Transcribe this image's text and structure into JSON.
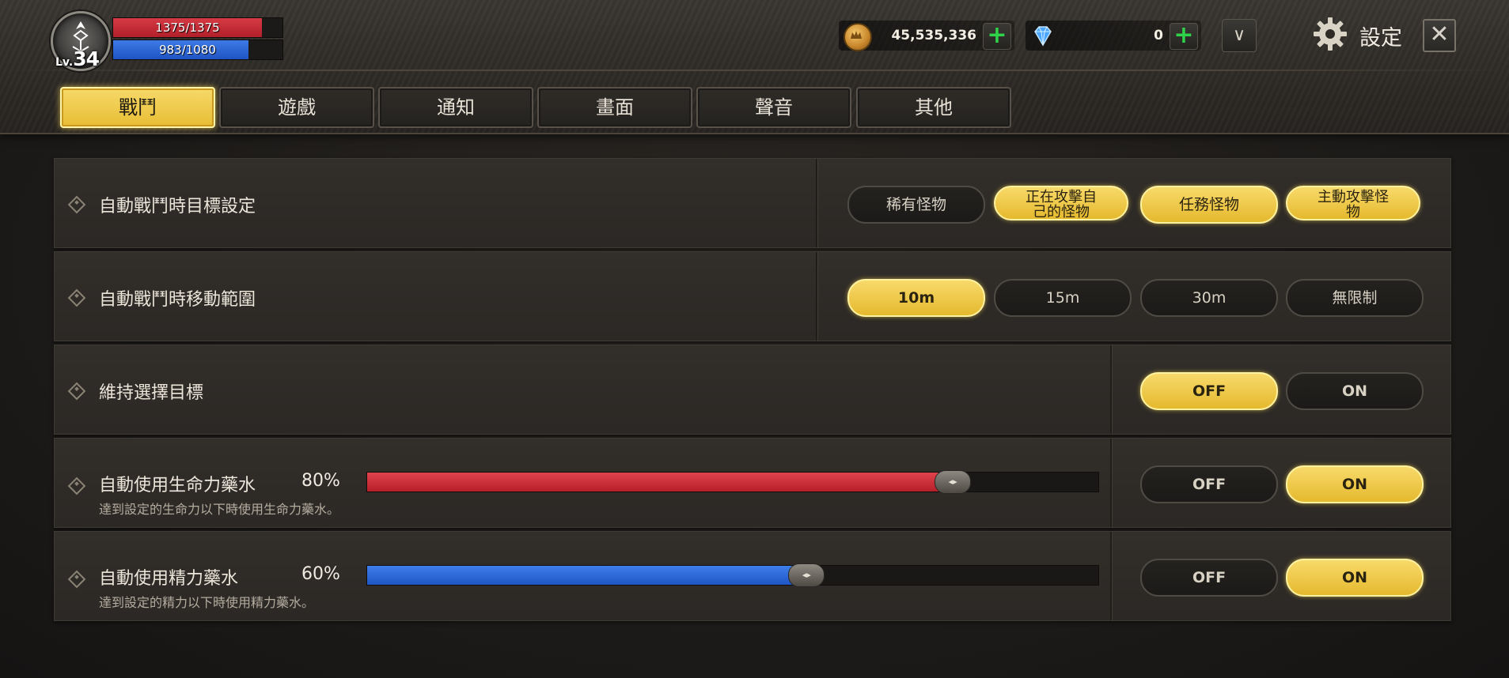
{
  "player": {
    "level_prefix": "Lv.",
    "level": "34",
    "hp_text": "1375/1375",
    "hp_fraction": 1.0,
    "mp_text": "983/1080",
    "mp_fraction": 0.91
  },
  "currency": {
    "gold": "45,535,336",
    "gems": "0",
    "plus_label": "+",
    "dropdown_icon": "∨"
  },
  "header": {
    "settings_label": "設定",
    "close_label": "✕"
  },
  "tabs": [
    {
      "label": "戰鬥",
      "active": true
    },
    {
      "label": "遊戲",
      "active": false
    },
    {
      "label": "通知",
      "active": false
    },
    {
      "label": "畫面",
      "active": false
    },
    {
      "label": "聲音",
      "active": false
    },
    {
      "label": "其他",
      "active": false
    }
  ],
  "rows": {
    "target": {
      "label": "自動戰鬥時目標設定",
      "options": [
        {
          "line1": "稀有怪物",
          "line2": "",
          "selected": false
        },
        {
          "line1": "正在攻擊自",
          "line2": "己的怪物",
          "selected": true
        },
        {
          "line1": "任務怪物",
          "line2": "",
          "selected": true
        },
        {
          "line1": "主動攻擊怪",
          "line2": "物",
          "selected": true
        }
      ]
    },
    "range": {
      "label": "自動戰鬥時移動範圍",
      "options": [
        {
          "label": "10m",
          "selected": true
        },
        {
          "label": "15m",
          "selected": false
        },
        {
          "label": "30m",
          "selected": false
        },
        {
          "label": "無限制",
          "selected": false
        }
      ]
    },
    "keep_target": {
      "label": "維持選擇目標",
      "off_label": "OFF",
      "on_label": "ON",
      "value": "OFF"
    },
    "hp_potion": {
      "label": "自動使用生命力藥水",
      "percent_text": "80%",
      "percent": 80,
      "desc": "達到設定的生命力以下時使用生命力藥水。",
      "off_label": "OFF",
      "on_label": "ON",
      "value": "ON"
    },
    "mp_potion": {
      "label": "自動使用精力藥水",
      "percent_text": "60%",
      "percent": 60,
      "desc": "達到設定的精力以下時使用精力藥水。",
      "off_label": "OFF",
      "on_label": "ON",
      "value": "ON"
    }
  },
  "colors": {
    "accent_gold": "#f0c94a",
    "hp_red": "#c82a34",
    "mp_blue": "#2b66d8",
    "plus_green": "#2fd34a"
  }
}
